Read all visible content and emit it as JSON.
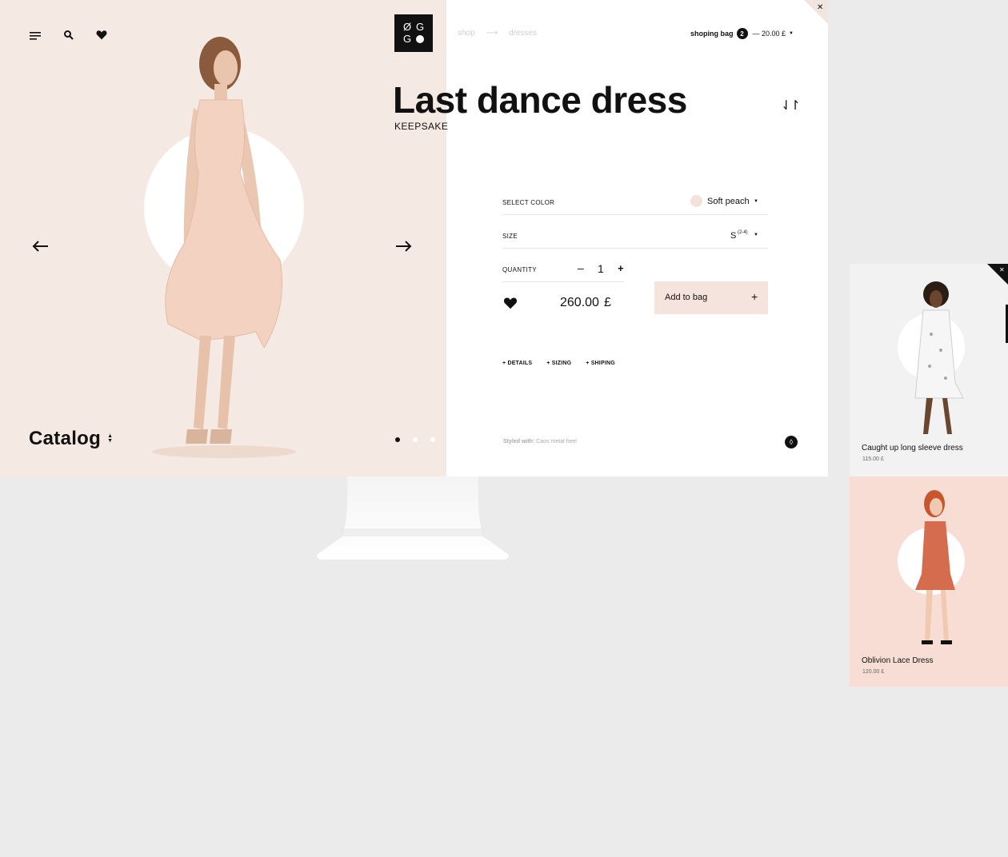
{
  "header": {
    "logo": [
      "Ø",
      "G",
      "G"
    ],
    "breadcrumb": [
      "shop",
      "dresses"
    ],
    "bag_label": "shoping bag",
    "bag_count": "2",
    "bag_total": "— 20.00 £"
  },
  "product": {
    "title": "Last dance dress",
    "brand": "KEEPSAKE",
    "color_label": "SELECT COLOR",
    "color_value": "Soft peach",
    "color_swatch": "#f3e2da",
    "size_label": "SIZE",
    "size_value": "S",
    "size_note": "(2-4)",
    "quantity_label": "QUANTITY",
    "quantity_value": "1",
    "price": "260.00",
    "currency": "£",
    "add_label": "Add to bag",
    "tabs": [
      "DETAILS",
      "SIZING",
      "SHIPING"
    ],
    "styled_label": "Styled with:",
    "styled_value": "Caos metal heel"
  },
  "gallery": {
    "catalog_label": "Catalog",
    "slides": 3
  },
  "related": [
    {
      "name": "Caught up long sleeve dress",
      "price": "115.00 £"
    },
    {
      "name": "Oblivion Lace Dress",
      "price": "120.00 £"
    }
  ],
  "colors": {
    "accent_pink": "#f5e9e4",
    "button_pink": "#f4e4dd",
    "card_pink": "#f7ddd4"
  }
}
